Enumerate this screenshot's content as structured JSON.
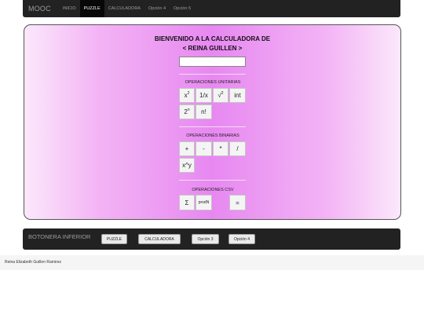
{
  "nav": {
    "brand": "MOOC",
    "items": [
      {
        "label": "INICIO"
      },
      {
        "label": "PUZZLE"
      },
      {
        "label": "CALCULADORA"
      },
      {
        "label": "Opción 4"
      },
      {
        "label": "Opción 5"
      }
    ]
  },
  "calculator": {
    "title_line1": "BIENVENIDO A LA CALCULADORA DE",
    "title_line2": "< REINA GUILLEN >",
    "display_value": "",
    "unary": {
      "label": "OPERACIONES UNITARIAS",
      "buttons": {
        "square_base": "x",
        "square_exp": "2",
        "reciprocal": "1/x",
        "sqrt": "√",
        "sqrt_exp": "2",
        "integer": "int",
        "pow2_base": "2",
        "pow2_exp": "n",
        "factorial": "n!"
      }
    },
    "binary": {
      "label": "OPERACIONES BINARIAS",
      "buttons": {
        "plus": "+",
        "minus": "-",
        "times": "*",
        "divide": "/",
        "power": "x^y"
      }
    },
    "csv": {
      "label": "OPERACIONES CSV",
      "buttons": {
        "sum": "Σ",
        "prodn": "prodN",
        "equals": "="
      }
    }
  },
  "footer": {
    "title": "BOTONERA INFERIOR",
    "buttons": [
      {
        "label": "PUZZLE"
      },
      {
        "label": "CALCULADORA"
      },
      {
        "label": "Opción 3"
      },
      {
        "label": "Opción 4"
      }
    ]
  },
  "credit": "Reina Elizabeth Guillen Ramirez",
  "colors": {
    "navbar": "#222222",
    "active_nav": "#080808",
    "panel_center": "#e788f1",
    "panel_edge": "#fbe8fb"
  }
}
